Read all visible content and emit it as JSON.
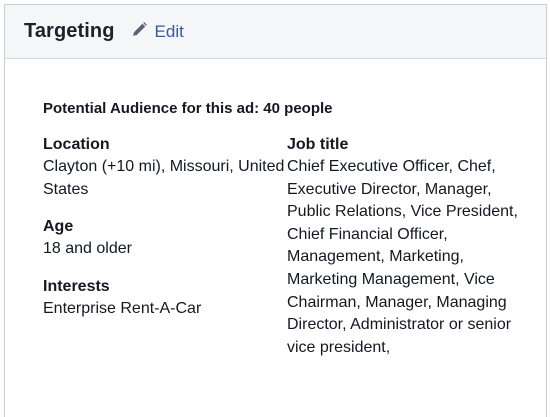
{
  "header": {
    "title": "Targeting",
    "edit_label": "Edit",
    "edit_icon": "pencil-icon"
  },
  "summary": {
    "audience_text": "Potential Audience for this ad: 40 people"
  },
  "details": {
    "location": {
      "label": "Location",
      "value": "Clayton (+10 mi), Missouri, United States"
    },
    "age": {
      "label": "Age",
      "value": "18 and older"
    },
    "interests": {
      "label": "Interests",
      "value": "Enterprise Rent-A-Car"
    },
    "job_title": {
      "label": "Job title",
      "value": "Chief Executive Officer, Chef, Executive Director, Manager, Public Relations, Vice President, Chief Financial Officer, Management, Marketing, Marketing Management, Vice Chairman, Manager, Managing Director, Administrator or senior vice president,"
    }
  },
  "colors": {
    "link": "#3b5998",
    "header_bg": "#f5f6f7",
    "border": "#c9cdd4"
  }
}
